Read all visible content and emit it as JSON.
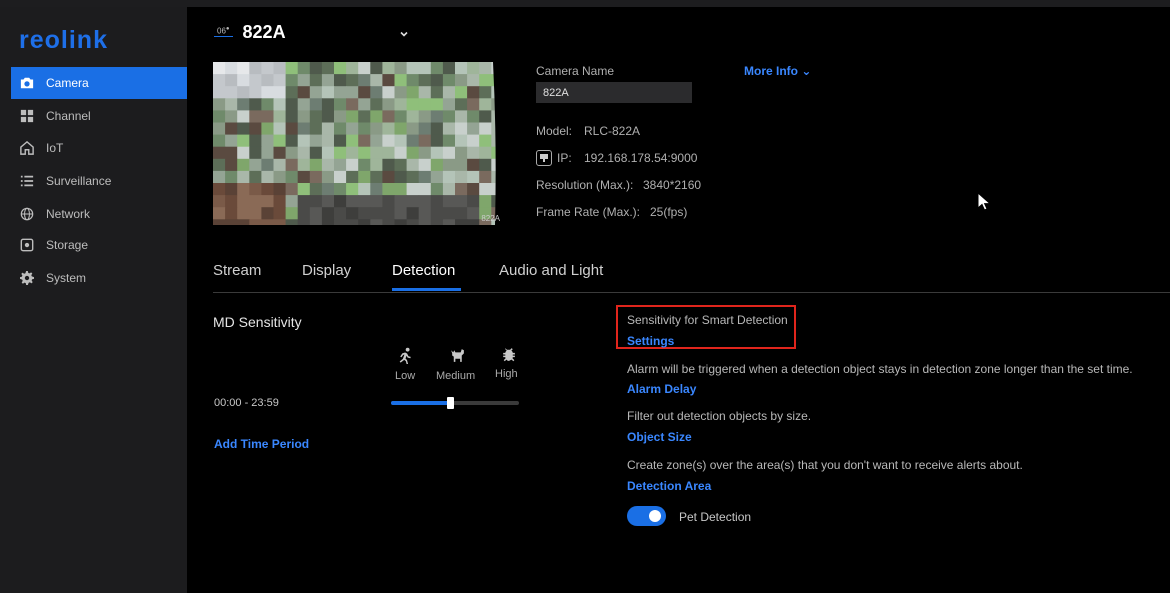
{
  "app": {
    "logo": "reolink",
    "accent": "#1a6fe5",
    "link_color": "#3a87ff"
  },
  "sidebar": {
    "items": [
      {
        "label": "Camera",
        "icon": "camera-icon",
        "active": true
      },
      {
        "label": "Channel",
        "icon": "grid-icon",
        "active": false
      },
      {
        "label": "IoT",
        "icon": "home-icon",
        "active": false
      },
      {
        "label": "Surveillance",
        "icon": "list-icon",
        "active": false
      },
      {
        "label": "Network",
        "icon": "globe-icon",
        "active": false
      },
      {
        "label": "Storage",
        "icon": "storage-icon",
        "active": false
      },
      {
        "label": "System",
        "icon": "gear-icon",
        "active": false
      }
    ]
  },
  "header": {
    "channel": "06",
    "title": "822A"
  },
  "camera_info": {
    "name_label": "Camera Name",
    "name_value": "822A",
    "more_info": "More Info ⌄",
    "model_label": "Model:",
    "model_value": "RLC-822A",
    "ip_label": "IP:",
    "ip_value": "192.168.178.54:9000",
    "resolution_label": "Resolution (Max.):",
    "resolution_value": "3840*2160",
    "framerate_label": "Frame Rate (Max.):",
    "framerate_value": "25(fps)",
    "preview_label": "822A"
  },
  "tabs": [
    {
      "label": "Stream",
      "active": false
    },
    {
      "label": "Display",
      "active": false
    },
    {
      "label": "Detection",
      "active": true
    },
    {
      "label": "Audio and Light",
      "active": false
    }
  ],
  "md": {
    "title": "MD Sensitivity",
    "levels": [
      "Low",
      "Medium",
      "High"
    ],
    "time_range": "00:00 - 23:59",
    "slider_value": 0.46,
    "add_time_period": "Add Time Period"
  },
  "smart": {
    "sensitivity_label": "Sensitivity for Smart Detection",
    "settings_link": "Settings",
    "alarm_desc": "Alarm will be triggered when a detection object stays in detection zone longer than the set time.",
    "alarm_link": "Alarm Delay",
    "size_desc": "Filter out detection objects by size.",
    "size_link": "Object Size",
    "zone_desc": "Create zone(s) over the area(s) that you don't want to receive alerts about.",
    "zone_link": "Detection Area",
    "pet_label": "Pet Detection",
    "pet_enabled": true,
    "highlight_color": "#e0251c"
  }
}
